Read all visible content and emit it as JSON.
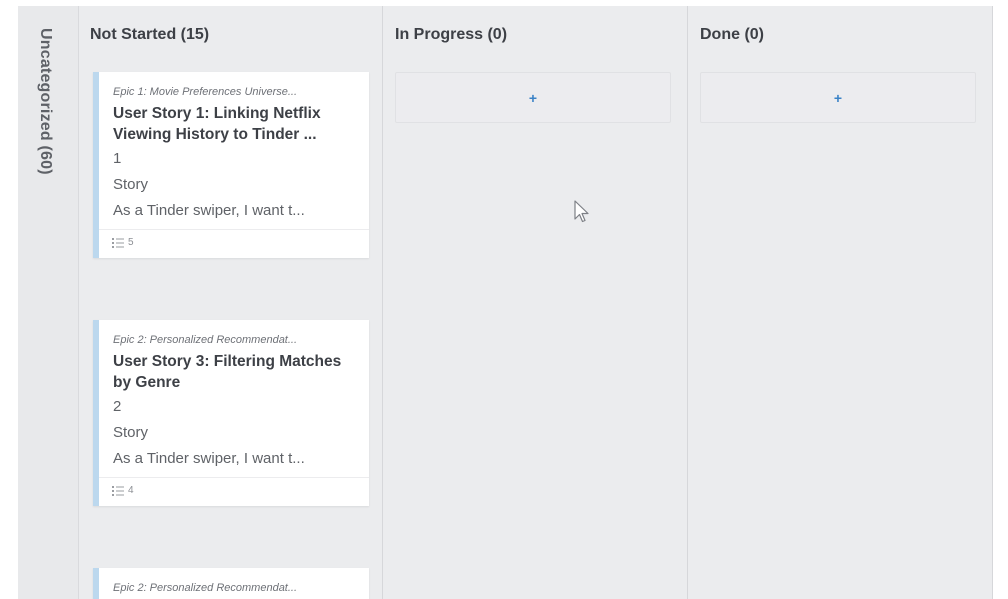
{
  "swimlane": {
    "label": "Uncategorized (60)"
  },
  "columns": [
    {
      "header": "Not Started (15)",
      "cards": [
        {
          "epic": "Epic 1: Movie Preferences Universe...",
          "title": "User Story 1: Linking Netflix Viewing History to Tinder ...",
          "points": "1",
          "type": "Story",
          "description": "As a Tinder swiper, I want t...",
          "task_count": "5"
        },
        {
          "epic": "Epic 2: Personalized Recommendat...",
          "title": "User Story 3: Filtering Matches by Genre",
          "points": "2",
          "type": "Story",
          "description": "As a Tinder swiper, I want t...",
          "task_count": "4"
        },
        {
          "epic": "Epic 2: Personalized Recommendat..."
        }
      ]
    },
    {
      "header": "In Progress (0)",
      "add_label": "+"
    },
    {
      "header": "Done (0)",
      "add_label": "+"
    }
  ],
  "colors": {
    "board_bg": "#ebecee",
    "card_accent": "#bcd8ee",
    "add_plus": "#3a82c6"
  },
  "icons": {
    "cursor": "mouse-pointer-icon",
    "tasks": "checklist-icon"
  }
}
